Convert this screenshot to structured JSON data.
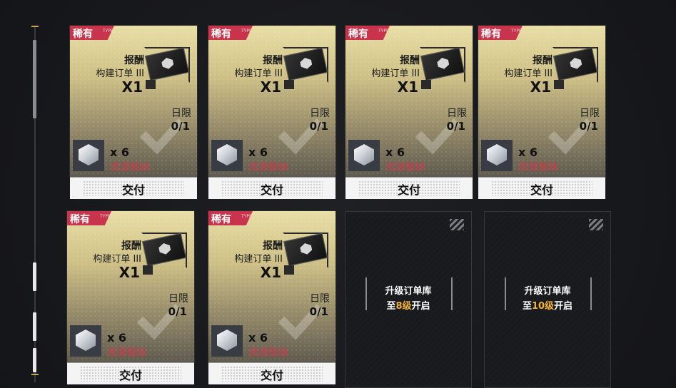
{
  "cards": [
    {
      "rarity": "稀有",
      "rarity_sub": "TYPE",
      "reward_label": "报酬",
      "order_name": "构建订单 III",
      "reward_qty": "X1",
      "limit_label": "日限",
      "limit_value": "0/1",
      "resource_count": "x 6",
      "resource_status": "资源暂缺",
      "deliver_label": "交付"
    },
    {
      "rarity": "稀有",
      "rarity_sub": "TYPE",
      "reward_label": "报酬",
      "order_name": "构建订单 III",
      "reward_qty": "X1",
      "limit_label": "日限",
      "limit_value": "0/1",
      "resource_count": "x 6",
      "resource_status": "资源暂缺",
      "deliver_label": "交付"
    },
    {
      "rarity": "稀有",
      "rarity_sub": "TYPE",
      "reward_label": "报酬",
      "order_name": "构建订单 III",
      "reward_qty": "X1",
      "limit_label": "日限",
      "limit_value": "0/1",
      "resource_count": "x 6",
      "resource_status": "资源暂缺",
      "deliver_label": "交付"
    },
    {
      "rarity": "稀有",
      "rarity_sub": "TYPE",
      "reward_label": "报酬",
      "order_name": "构建订单 III",
      "reward_qty": "X1",
      "limit_label": "日限",
      "limit_value": "0/1",
      "resource_count": "x 6",
      "resource_status": "资源暂缺",
      "deliver_label": "交付"
    },
    {
      "rarity": "稀有",
      "rarity_sub": "TYPE",
      "reward_label": "报酬",
      "order_name": "构建订单 III",
      "reward_qty": "X1",
      "limit_label": "日限",
      "limit_value": "0/1",
      "resource_count": "x 6",
      "resource_status": "资源暂缺",
      "deliver_label": "交付"
    },
    {
      "rarity": "稀有",
      "rarity_sub": "TYPE",
      "reward_label": "报酬",
      "order_name": "构建订单 III",
      "reward_qty": "X1",
      "limit_label": "日限",
      "limit_value": "0/1",
      "resource_count": "x 6",
      "resource_status": "资源暂缺",
      "deliver_label": "交付"
    }
  ],
  "locked_slots": [
    {
      "line1": "升级订单库",
      "line2_prefix": "至",
      "line2_level": "8级",
      "line2_suffix": "开启"
    },
    {
      "line1": "升级订单库",
      "line2_prefix": "至",
      "line2_level": "10级",
      "line2_suffix": "开启"
    }
  ],
  "colors": {
    "rarity": "#c8344c",
    "shortage": "#d03a4a",
    "level_highlight": "#f2b33a",
    "card_gold": "#e9dfa6"
  },
  "icons": {
    "reward": "order-ticket-icon",
    "resource": "crystal-cube-icon",
    "locked": "striped-corner-icon",
    "check": "checkmark-watermark-icon"
  }
}
